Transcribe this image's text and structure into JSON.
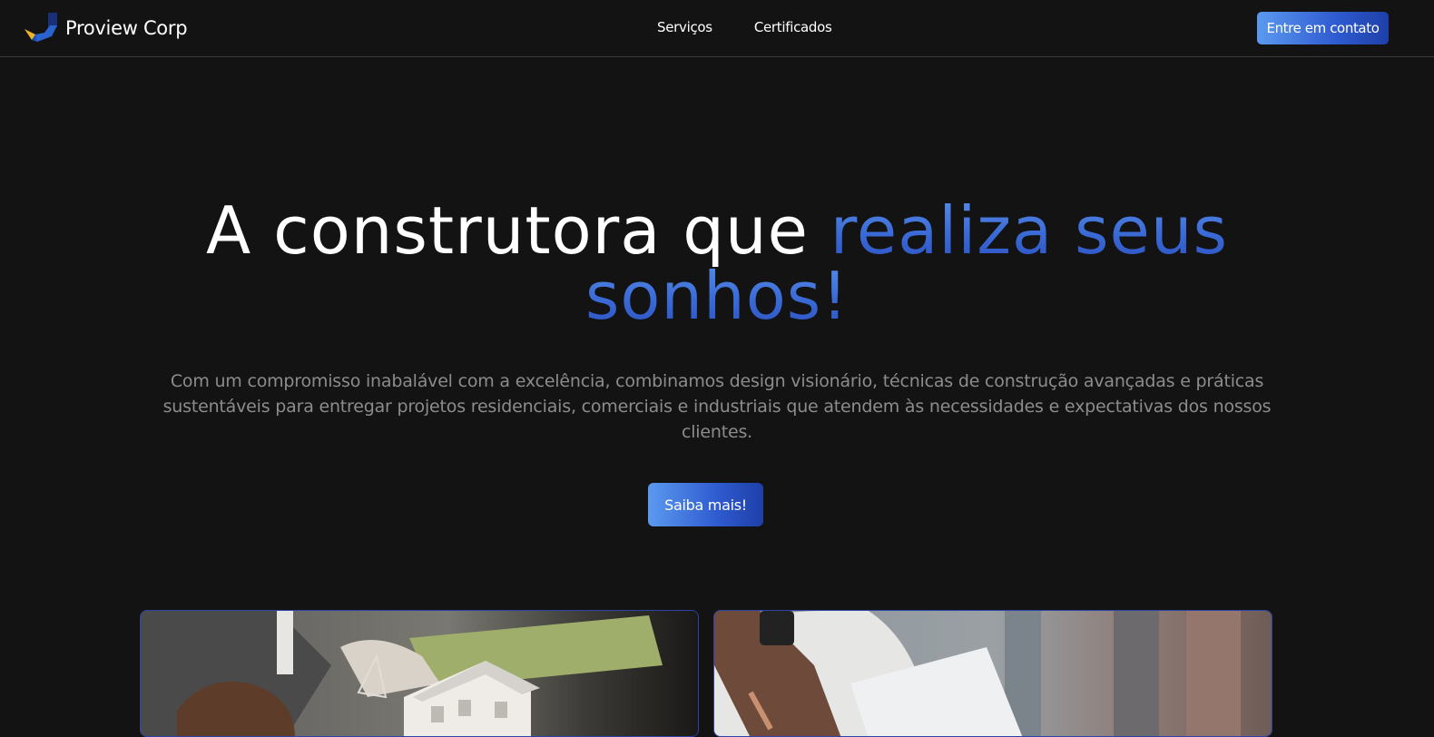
{
  "nav": {
    "brand": "Proview Corp",
    "links": [
      "Serviços",
      "Certificados"
    ],
    "cta": "Entre em contato"
  },
  "hero": {
    "title_part1": "A construtora que ",
    "title_accent_line1": "realiza seus",
    "title_accent_line2": "sonhos!",
    "description": "Com um compromisso inabalável com a excelência, combinamos design visionário, técnicas de construção avançadas e práticas sustentáveis para entregar projetos residenciais, comerciais e industriais que atendem às necessidades e expectativas dos nossos clientes.",
    "button": "Saiba mais!"
  },
  "cards": [
    {
      "image": "architect-house-model-photo"
    },
    {
      "image": "engineer-blueprint-hardhat-photo"
    }
  ],
  "colors": {
    "background": "#131313",
    "accent_light": "#5a90e8",
    "accent_dark": "#2b4fc0",
    "muted_text": "#8c8c8c"
  }
}
